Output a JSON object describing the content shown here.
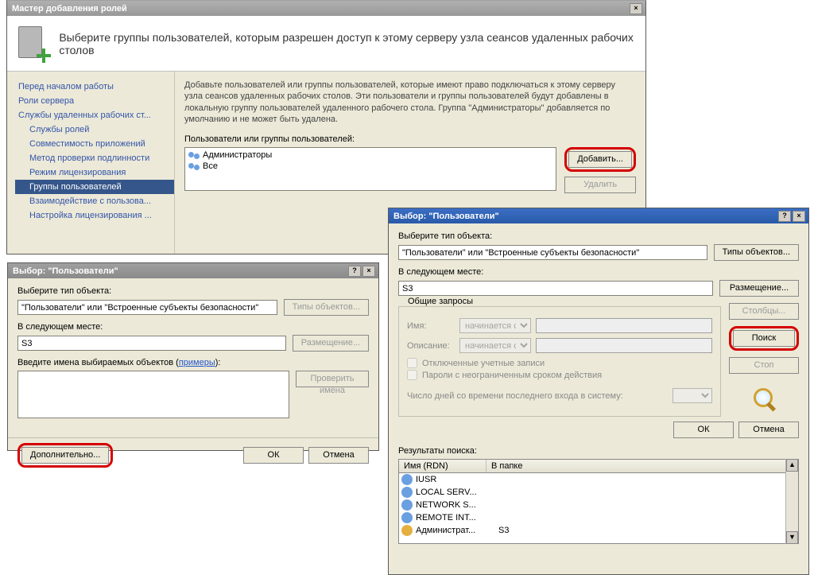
{
  "main": {
    "title": "Мастер добавления ролей",
    "heading": "Выберите группы пользователей, которым разрешен доступ к этому серверу узла сеансов удаленных рабочих столов",
    "steps": [
      "Перед началом работы",
      "Роли сервера",
      "Службы удаленных рабочих ст...",
      "Службы ролей",
      "Совместимость приложений",
      "Метод проверки подлинности",
      "Режим лицензирования",
      "Группы пользователей",
      "Взаимодействие с пользова...",
      "Настройка лицензирования ..."
    ],
    "desc": "Добавьте пользователей или группы пользователей, которые имеют право подключаться к этому серверу узла сеансов удаленных рабочих столов. Эти пользователи и группы пользователей будут добавлены в локальную группу пользователей удаленного рабочего стола. Группа \"Администраторы\" добавляется по умолчанию и не может быть удалена.",
    "list_label": "Пользователи или группы пользователей:",
    "list_items": [
      "Администраторы",
      "Все"
    ],
    "add_btn": "Добавить...",
    "remove_btn": "Удалить"
  },
  "sel1": {
    "title": "Выбор: \"Пользователи\"",
    "objtype_label": "Выберите тип объекта:",
    "objtype_value": "\"Пользователи\" или \"Встроенные субъекты безопасности\"",
    "objtype_btn": "Типы объектов...",
    "loc_label": "В следующем месте:",
    "loc_value": "S3",
    "loc_btn": "Размещение...",
    "names_label_pre": "Введите имена выбираемых объектов (",
    "names_label_link": "примеры",
    "names_label_post": "):",
    "check_btn": "Проверить имена",
    "adv_btn": "Дополнительно...",
    "ok_btn": "ОК",
    "cancel_btn": "Отмена"
  },
  "sel2": {
    "title": "Выбор: \"Пользователи\"",
    "objtype_label": "Выберите тип объекта:",
    "objtype_value": "\"Пользователи\" или \"Встроенные субъекты безопасности\"",
    "objtype_btn": "Типы объектов...",
    "loc_label": "В следующем месте:",
    "loc_value": "S3",
    "loc_btn": "Размещение...",
    "queries_title": "Общие запросы",
    "name_label": "Имя:",
    "desc_label": "Описание:",
    "starts_with": "начинается с",
    "chk_disabled": "Отключенные учетные записи",
    "chk_nopwexpire": "Пароли с неограниченным сроком действия",
    "days_label": "Число дней со времени последнего входа в систему:",
    "columns_btn": "Столбцы...",
    "search_btn": "Поиск",
    "stop_btn": "Стоп",
    "ok_btn": "ОК",
    "cancel_btn": "Отмена",
    "results_label": "Результаты поиска:",
    "col_name": "Имя (RDN)",
    "col_folder": "В папке",
    "results": [
      {
        "name": "IUSR",
        "folder": ""
      },
      {
        "name": "LOCAL SERV...",
        "folder": ""
      },
      {
        "name": "NETWORK S...",
        "folder": ""
      },
      {
        "name": "REMOTE INT...",
        "folder": ""
      },
      {
        "name": "Администрат...",
        "folder": "S3"
      }
    ]
  }
}
